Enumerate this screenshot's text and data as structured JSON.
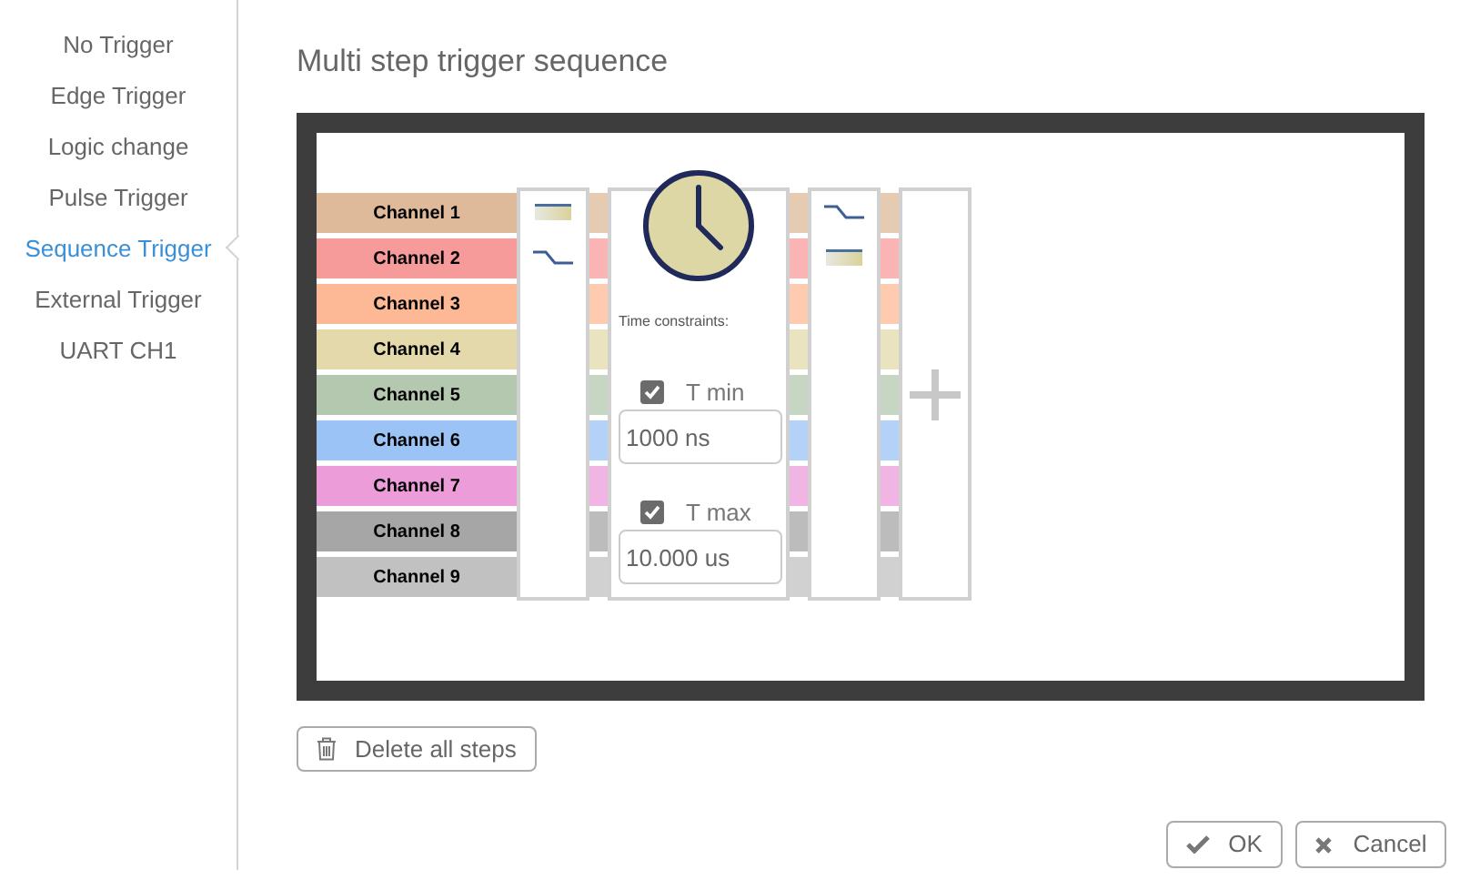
{
  "sidebar": {
    "items": [
      {
        "label": "No Trigger",
        "selected": false
      },
      {
        "label": "Edge Trigger",
        "selected": false
      },
      {
        "label": "Logic change",
        "selected": false
      },
      {
        "label": "Pulse Trigger",
        "selected": false
      },
      {
        "label": "Sequence Trigger",
        "selected": true
      },
      {
        "label": "External Trigger",
        "selected": false
      },
      {
        "label": "UART CH1",
        "selected": false
      }
    ]
  },
  "title": "Multi step trigger sequence",
  "channels": [
    {
      "name": "Channel 1",
      "color": "#deb99a"
    },
    {
      "name": "Channel 2",
      "color": "#f79b9a"
    },
    {
      "name": "Channel 3",
      "color": "#fdb995"
    },
    {
      "name": "Channel 4",
      "color": "#e3d9ab"
    },
    {
      "name": "Channel 5",
      "color": "#b3c8ae"
    },
    {
      "name": "Channel 6",
      "color": "#9bc3f5"
    },
    {
      "name": "Channel 7",
      "color": "#eb9cd9"
    },
    {
      "name": "Channel 8",
      "color": "#a6a6a6"
    },
    {
      "name": "Channel 9",
      "color": "#c1c1c1"
    }
  ],
  "steps": [
    {
      "kind": "conditions",
      "conditions": [
        {
          "kind": "level"
        },
        {
          "kind": "falling_edge"
        }
      ]
    },
    {
      "kind": "time",
      "label": "Time constraints:",
      "t_min": {
        "label": "T min",
        "checked": true,
        "value": "1000 ns"
      },
      "t_max": {
        "label": "T max",
        "checked": true,
        "value": "10.000 us"
      }
    },
    {
      "kind": "conditions",
      "conditions": [
        {
          "kind": "falling_edge"
        },
        {
          "kind": "level"
        }
      ]
    },
    {
      "kind": "add"
    }
  ],
  "delete_button": "Delete all steps",
  "ok_button": "OK",
  "cancel_button": "Cancel"
}
